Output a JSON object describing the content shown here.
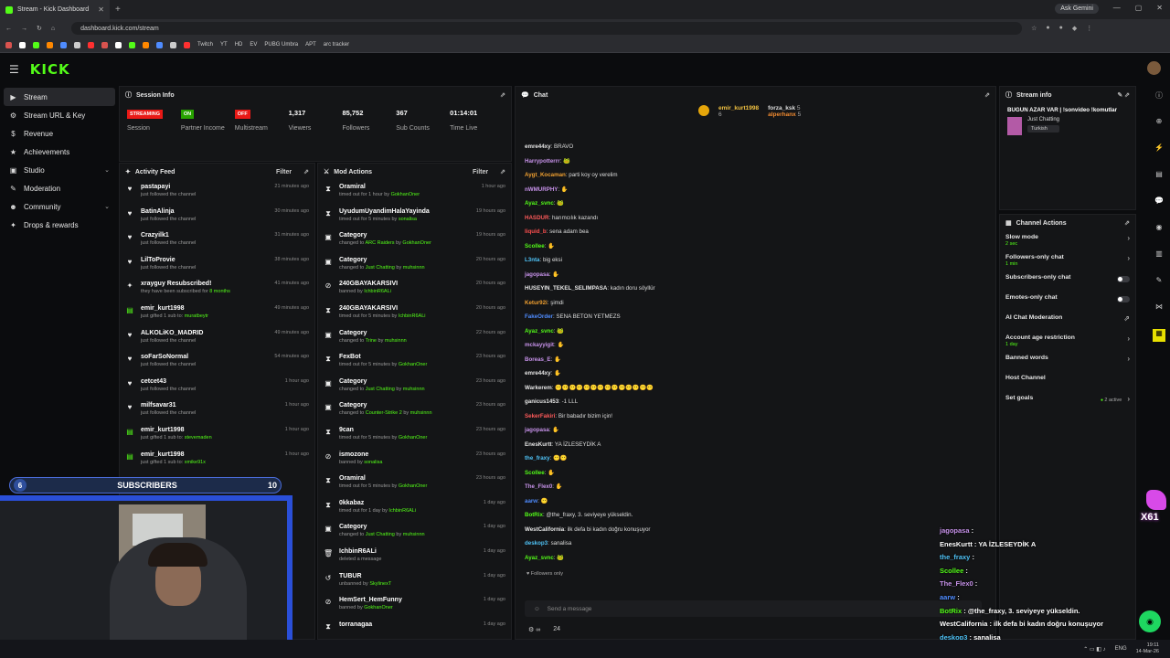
{
  "browser": {
    "tab_title": "Stream - Kick Dashboard",
    "url": "dashboard.kick.com/stream",
    "gemini_label": "Ask Gemini",
    "bookmarks": [
      "Twitch",
      "YT",
      "HD",
      "EV",
      "PUBG Umbra",
      "APT",
      "arc tracker"
    ]
  },
  "app": {
    "logo": "KICK",
    "sidebar": [
      {
        "label": "Stream",
        "icon": "▶",
        "active": true
      },
      {
        "label": "Stream URL & Key",
        "icon": "⚙"
      },
      {
        "label": "Revenue",
        "icon": "$"
      },
      {
        "label": "Achievements",
        "icon": "★"
      },
      {
        "label": "Studio",
        "icon": "▣",
        "chev": true
      },
      {
        "label": "Moderation",
        "icon": "✎"
      },
      {
        "label": "Community",
        "icon": "☻",
        "chev": true
      },
      {
        "label": "Drops & rewards",
        "icon": "✦"
      }
    ]
  },
  "session": {
    "title": "Session Info",
    "stats": [
      {
        "badge": "STREAMING",
        "badge_color": "#e91916",
        "label": "Session"
      },
      {
        "badge": "ON",
        "badge_color": "#27a300",
        "label": "Partner Income"
      },
      {
        "badge": "OFF",
        "badge_color": "#e91916",
        "label": "Multistream"
      },
      {
        "value": "1,317",
        "label": "Viewers"
      },
      {
        "value": "85,752",
        "label": "Followers"
      },
      {
        "value": "367",
        "label": "Sub Counts"
      },
      {
        "value": "01:14:01",
        "label": "Time Live"
      }
    ]
  },
  "activity": {
    "title": "Activity Feed",
    "filter": "Filter",
    "items": [
      {
        "icon": "♥",
        "name": "pastapayi",
        "sub": "just followed the channel",
        "time": "21 minutes ago"
      },
      {
        "icon": "♥",
        "name": "BatinAlinja",
        "sub": "just followed the channel",
        "time": "30 minutes ago"
      },
      {
        "icon": "♥",
        "name": "Crazyilk1",
        "sub": "just followed the channel",
        "time": "31 minutes ago"
      },
      {
        "icon": "♥",
        "name": "LilToProvie",
        "sub": "just followed the channel",
        "time": "38 minutes ago"
      },
      {
        "icon": "✦",
        "name": "xrayguy Resubscribed!",
        "sub_pre": "they have been subscribed for ",
        "sub_green": "8 months",
        "time": "41 minutes ago"
      },
      {
        "icon": "▤",
        "name": "emir_kurt1998",
        "sub_pre": "just gifted 1 sub to: ",
        "sub_green": "muratbeytr",
        "time": "49 minutes ago"
      },
      {
        "icon": "♥",
        "name": "ALKOLiKO_MADRID",
        "sub": "just followed the channel",
        "time": "49 minutes ago"
      },
      {
        "icon": "♥",
        "name": "soFarSoNormal",
        "sub": "just followed the channel",
        "time": "54 minutes ago"
      },
      {
        "icon": "♥",
        "name": "cetcet43",
        "sub": "just followed the channel",
        "time": "1 hour ago"
      },
      {
        "icon": "♥",
        "name": "milfsavar31",
        "sub": "just followed the channel",
        "time": "1 hour ago"
      },
      {
        "icon": "▤",
        "name": "emir_kurt1998",
        "sub_pre": "just gifted 1 sub to: ",
        "sub_green": "stevemaden",
        "time": "1 hour ago"
      },
      {
        "icon": "▤",
        "name": "emir_kurt1998",
        "sub_pre": "just gifted 1 sub to: ",
        "sub_green": "xmike91x",
        "time": "1 hour ago"
      }
    ]
  },
  "mod": {
    "title": "Mod Actions",
    "filter": "Filter",
    "items": [
      {
        "icon": "⧗",
        "name": "Oramiral",
        "sub_pre": "timed out for 1 hour by ",
        "sub_green": "GokhanOner",
        "time": "1 hour ago"
      },
      {
        "icon": "⧗",
        "name": "UyudumUyandimHalaYayinda",
        "sub_pre": "timed out for 5 minutes by ",
        "sub_green": "sonalisa",
        "time": "19 hours ago"
      },
      {
        "icon": "▣",
        "name": "Category",
        "sub_pre": "changed to ",
        "sub_green": "ARC Raiders",
        "sub_mid": " by ",
        "sub_green2": "GokhanOner",
        "time": "19 hours ago"
      },
      {
        "icon": "▣",
        "name": "Category",
        "sub_pre": "changed to ",
        "sub_green": "Just Chatting",
        "sub_mid": " by ",
        "sub_green2": "muhsinnn",
        "time": "20 hours ago"
      },
      {
        "icon": "⊘",
        "name": "240GBAYAKARSIVI",
        "sub_pre": "banned by ",
        "sub_green": "IchbinR6ALi",
        "time": "20 hours ago"
      },
      {
        "icon": "⧗",
        "name": "240GBAYAKARSIVI",
        "sub_pre": "timed out for 5 minutes by ",
        "sub_green": "IchbinR6ALi",
        "time": "20 hours ago"
      },
      {
        "icon": "▣",
        "name": "Category",
        "sub_pre": "changed to ",
        "sub_green": "Trine",
        "sub_mid": " by ",
        "sub_green2": "muhsinnn",
        "time": "22 hours ago"
      },
      {
        "icon": "⧗",
        "name": "FexBot",
        "sub_pre": "timed out for 5 minutes by ",
        "sub_green": "GokhanOner",
        "time": "23 hours ago"
      },
      {
        "icon": "▣",
        "name": "Category",
        "sub_pre": "changed to ",
        "sub_green": "Just Chatting",
        "sub_mid": " by ",
        "sub_green2": "muhsinnn",
        "time": "23 hours ago"
      },
      {
        "icon": "▣",
        "name": "Category",
        "sub_pre": "changed to ",
        "sub_green": "Counter-Strike 2",
        "sub_mid": " by ",
        "sub_green2": "muhsinnn",
        "time": "23 hours ago"
      },
      {
        "icon": "⧗",
        "name": "9can",
        "sub_pre": "timed out for 5 minutes by ",
        "sub_green": "GokhanOner",
        "time": "23 hours ago"
      },
      {
        "icon": "⊘",
        "name": "ismozone",
        "sub_pre": "banned by ",
        "sub_green": "sonalisa",
        "time": "23 hours ago"
      },
      {
        "icon": "⧗",
        "name": "Oramiral",
        "sub_pre": "timed out for 5 minutes by ",
        "sub_green": "GokhanOner",
        "time": "23 hours ago"
      },
      {
        "icon": "⧗",
        "name": "0kkabaz",
        "sub_pre": "timed out for 1 day by ",
        "sub_green": "IchbinR6ALi",
        "time": "1 day ago"
      },
      {
        "icon": "▣",
        "name": "Category",
        "sub_pre": "changed to ",
        "sub_green": "Just Chatting",
        "sub_mid": " by ",
        "sub_green2": "muhsinnn",
        "time": "1 day ago"
      },
      {
        "icon": "🗑",
        "name": "IchbinR6ALi",
        "sub": "deleted a message",
        "time": "1 day ago"
      },
      {
        "icon": "↺",
        "name": "TUBUR",
        "sub_pre": "unbanned by ",
        "sub_green": "SkylinexT",
        "time": "1 day ago"
      },
      {
        "icon": "⊘",
        "name": "HemSert_HemFunny",
        "sub_pre": "banned by ",
        "sub_green": "GokhanOner",
        "time": "1 day ago"
      },
      {
        "icon": "⧗",
        "name": "torranagaa",
        "sub": "",
        "time": "1 day ago"
      }
    ]
  },
  "chat": {
    "title": "Chat",
    "pinned": {
      "user": "emir_kurt1998",
      "count": "6",
      "u2": "forza_ksk",
      "c2": "5",
      "u3": "alperhanx",
      "c3": "5"
    },
    "lines": [
      {
        "user": "emre44xy",
        "color": "#e6e6e6",
        "msg": "BRAVO"
      },
      {
        "user": "Harrypotterrr",
        "color": "#c792ea",
        "msg": "🐸"
      },
      {
        "user": "Aygt_Kocaman",
        "color": "#f0a030",
        "msg": "parti koy oy verelim"
      },
      {
        "user": "nWMURPHY",
        "color": "#c792ea",
        "msg": "✋"
      },
      {
        "user": "Ayaz_svnc",
        "color": "#53fc18",
        "msg": "🐸"
      },
      {
        "user": "HASDUR",
        "color": "#ff5a5a",
        "msg": "harımcılık kazandı"
      },
      {
        "user": "liquid_b",
        "color": "#ff4f4f",
        "msg": "sena adam bea"
      },
      {
        "user": "Scollee",
        "color": "#53fc18",
        "msg": "✋"
      },
      {
        "user": "L3nta",
        "color": "#4fc3f7",
        "msg": "big eksi"
      },
      {
        "user": "jagopasa",
        "color": "#c792ea",
        "msg": "✋"
      },
      {
        "user": "HUSEYIN_TEKEL_SELIMPASA",
        "color": "#e6e6e6",
        "msg": "kadın doru söyllür"
      },
      {
        "user": "Ketur92i",
        "color": "#f0a030",
        "msg": "şimdi"
      },
      {
        "user": "FakeOrder",
        "color": "#4f8cff",
        "msg": "SENA BETON YETMEZS"
      },
      {
        "user": "Ayaz_svnc",
        "color": "#53fc18",
        "msg": "🐸"
      },
      {
        "user": "mckayyigit",
        "color": "#c792ea",
        "msg": "✋"
      },
      {
        "user": "Boreas_E",
        "color": "#c792ea",
        "msg": "✋"
      },
      {
        "user": "emre44xy",
        "color": "#e6e6e6",
        "msg": "✋"
      },
      {
        "user": "Warkerem",
        "color": "#e6e6e6",
        "msg": "😶😶😶😶😶😶😶😶😶😶😶😶😶😶"
      },
      {
        "user": "ganicus1453",
        "color": "#e6e6e6",
        "msg": "-1 LLL"
      },
      {
        "user": "SekerFakiri",
        "color": "#ff5a5a",
        "msg": "Bir babadır bizim için!"
      },
      {
        "user": "jagopasa",
        "color": "#c792ea",
        "msg": "✋"
      },
      {
        "user": "EnesKurtt",
        "color": "#e6e6e6",
        "msg": "YA İZLESEYDİK A"
      },
      {
        "user": "the_fraxy",
        "color": "#4fc3f7",
        "msg": "😶😶"
      },
      {
        "user": "Scollee",
        "color": "#53fc18",
        "msg": "✋"
      },
      {
        "user": "The_Flex0",
        "color": "#c792ea",
        "msg": "✋"
      },
      {
        "user": "aarw",
        "color": "#4f8cff",
        "msg": "😶"
      },
      {
        "user": "BotRix",
        "color": "#53fc18",
        "msg": "@the_fraxy, 3. seviyeye yükseldin."
      },
      {
        "user": "WestCalifornia",
        "color": "#e6e6e6",
        "msg": "ilk defa bi kadın doğru konuşuyor"
      },
      {
        "user": "deskop3",
        "color": "#4fc3f7",
        "msg": "sanalisa"
      },
      {
        "user": "Ayaz_svnc",
        "color": "#53fc18",
        "msg": "🐸"
      }
    ],
    "followers_only": "Followers only",
    "placeholder": "Send a message",
    "viewers": "24"
  },
  "stream_info": {
    "title": "Stream info",
    "stream_title": "BUGUN AZAR VAR | !sonvideo !komutlar",
    "category": "Just Chatting",
    "tag": "Turkish"
  },
  "channel_actions": {
    "title": "Channel Actions",
    "rows": [
      {
        "label": "Slow mode",
        "sub": "2 sec",
        "kind": "chev"
      },
      {
        "label": "Followers-only chat",
        "sub": "1 min",
        "kind": "chev"
      },
      {
        "label": "Subscribers-only chat",
        "sub": "",
        "kind": "toggle"
      },
      {
        "label": "Emotes-only chat",
        "sub": "",
        "kind": "toggle"
      },
      {
        "label": "AI Chat Moderation",
        "sub": "",
        "kind": "pop"
      },
      {
        "label": "Account age restriction",
        "sub": "1 day",
        "kind": "chev"
      },
      {
        "label": "Banned words",
        "sub": "",
        "kind": "chev"
      },
      {
        "label": "Host Channel",
        "sub": "",
        "kind": "none"
      },
      {
        "label": "Set goals",
        "sub": "",
        "kind": "chev",
        "extra": "2 active"
      }
    ]
  },
  "overlay": {
    "sub_left": "6",
    "sub_label": "SUBSCRIBERS",
    "sub_right": "10",
    "combo": "X61",
    "chat": [
      {
        "user": "jagopasa",
        "color": "#c792ea",
        "msg": ""
      },
      {
        "user": "EnesKurtt",
        "color": "#ffffff",
        "msg": "YA İZLESEYDİK A"
      },
      {
        "user": "the_fraxy",
        "color": "#4fc3f7",
        "msg": ""
      },
      {
        "user": "Scollee",
        "color": "#53fc18",
        "msg": ""
      },
      {
        "user": "The_Flex0",
        "color": "#c792ea",
        "msg": ""
      },
      {
        "user": "aarw",
        "color": "#4f8cff",
        "msg": ""
      },
      {
        "user": "BotRix",
        "color": "#53fc18",
        "msg": "@the_fraxy, 3. seviyeye yükseldin."
      },
      {
        "user": "WestCalifornia",
        "color": "#ffffff",
        "msg": "ilk defa bi kadın doğru konuşuyor"
      },
      {
        "user": "deskop3",
        "color": "#4fc3f7",
        "msg": "sanalisa"
      },
      {
        "user": "Ayaz_svnc",
        "color": "#53fc18",
        "msg": ""
      }
    ]
  },
  "taskbar": {
    "lang": "ENG",
    "time": "19:11",
    "date": "14-Mar-26"
  }
}
